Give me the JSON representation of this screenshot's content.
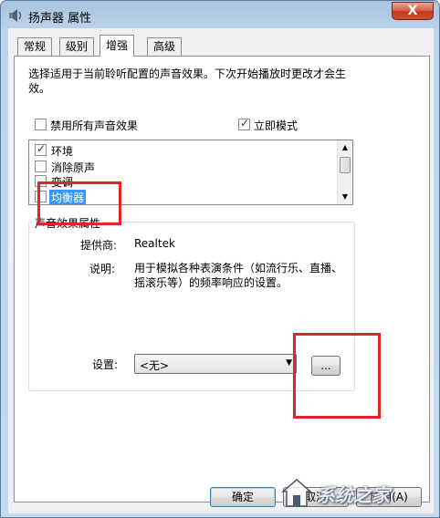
{
  "window": {
    "title": "扬声器 属性",
    "close_label": "X"
  },
  "tabs": [
    {
      "label": "常规"
    },
    {
      "label": "级别"
    },
    {
      "label": "增强"
    },
    {
      "label": "高级"
    }
  ],
  "description": "选择适用于当前聆听配置的声音效果。下次开始播放时更改才会生效。",
  "options": {
    "disable_all": {
      "label": "禁用所有声音效果",
      "checked": false
    },
    "immediate": {
      "label": "立即模式",
      "checked": true
    }
  },
  "effects": [
    {
      "label": "环境",
      "checked": true
    },
    {
      "label": "消除原声",
      "checked": false
    },
    {
      "label": "变调",
      "checked": false
    },
    {
      "label": "均衡器",
      "checked": false,
      "selected": true
    }
  ],
  "properties": {
    "title": "声音效果属性",
    "provider_label": "提供商:",
    "provider_value": "Realtek",
    "desc_label": "说明:",
    "desc_value": "用于模拟各种表演条件（如流行乐、直播、摇滚乐等）的频率响应的设置。",
    "settings_label": "设置:",
    "settings_value": "<无>",
    "more_button": "..."
  },
  "buttons": {
    "ok": "确定",
    "cancel": "取消",
    "apply": "应用(A)"
  },
  "watermark": {
    "text": "系统之家"
  },
  "colors": {
    "highlight": "#e0262a",
    "selection": "#3399ff"
  }
}
